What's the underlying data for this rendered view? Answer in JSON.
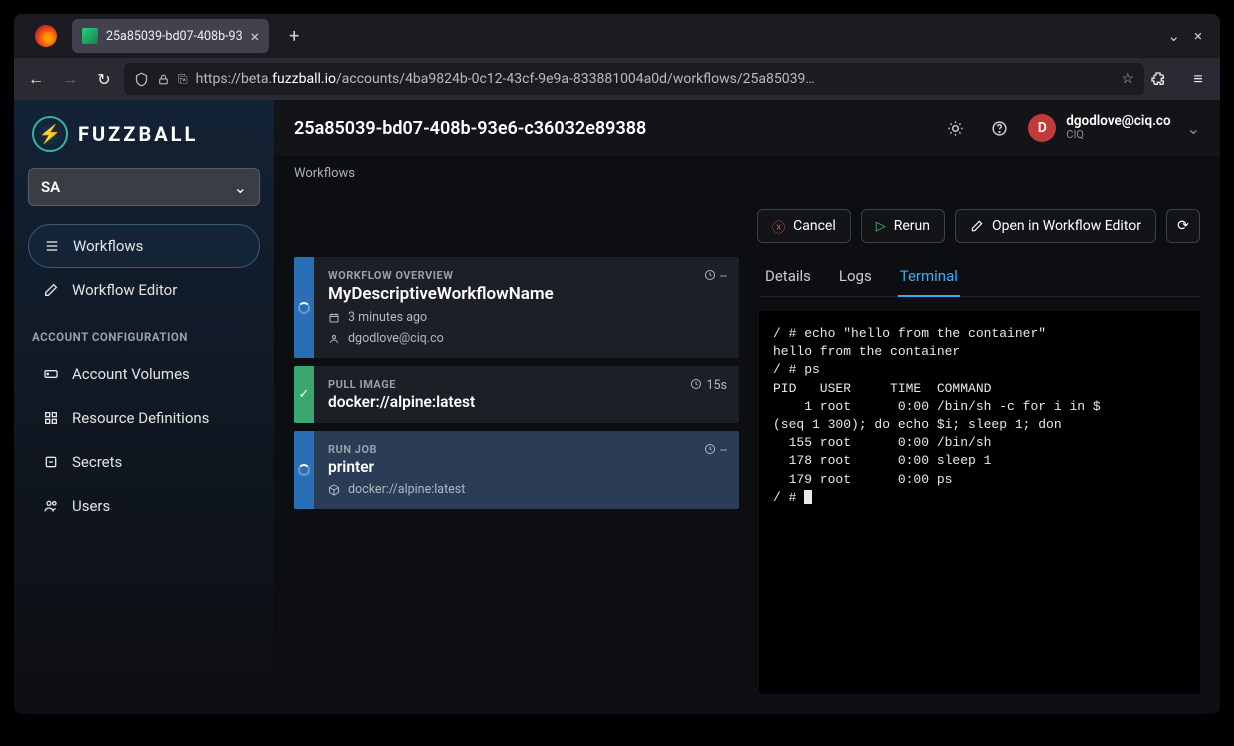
{
  "browser": {
    "tab_title": "25a85039-bd07-408b-93",
    "url_prefix": "https://beta.",
    "url_host": "fuzzball.io",
    "url_path": "/accounts/4ba9824b-0c12-43cf-9e9a-833881004a0d/workflows/25a85039…"
  },
  "app": {
    "logo_text": "FUZZBALL",
    "context": "SA",
    "nav": {
      "workflows": "Workflows",
      "editor": "Workflow Editor",
      "section": "ACCOUNT CONFIGURATION",
      "volumes": "Account Volumes",
      "resources": "Resource Definitions",
      "secrets": "Secrets",
      "users": "Users"
    },
    "page_title": "25a85039-bd07-408b-93e6-c36032e89388",
    "user": {
      "initial": "D",
      "email": "dgodlove@ciq.co",
      "org": "CIQ"
    },
    "breadcrumb": "Workflows",
    "buttons": {
      "cancel": "Cancel",
      "rerun": "Rerun",
      "open": "Open in Workflow Editor"
    },
    "cards": {
      "overview": {
        "label": "WORKFLOW OVERVIEW",
        "title": "MyDescriptiveWorkflowName",
        "time": "3 minutes ago",
        "owner": "dgodlove@ciq.co",
        "duration": "--"
      },
      "pull": {
        "label": "PULL IMAGE",
        "title": "docker://alpine:latest",
        "duration": "15s"
      },
      "run": {
        "label": "RUN JOB",
        "title": "printer",
        "image": "docker://alpine:latest",
        "duration": "--"
      }
    },
    "tabs": {
      "details": "Details",
      "logs": "Logs",
      "terminal": "Terminal"
    },
    "terminal_output": "/ # echo \"hello from the container\"\nhello from the container\n/ # ps\nPID   USER     TIME  COMMAND\n    1 root      0:00 /bin/sh -c for i in $\n(seq 1 300); do echo $i; sleep 1; don\n  155 root      0:00 /bin/sh\n  178 root      0:00 sleep 1\n  179 root      0:00 ps\n/ # "
  }
}
